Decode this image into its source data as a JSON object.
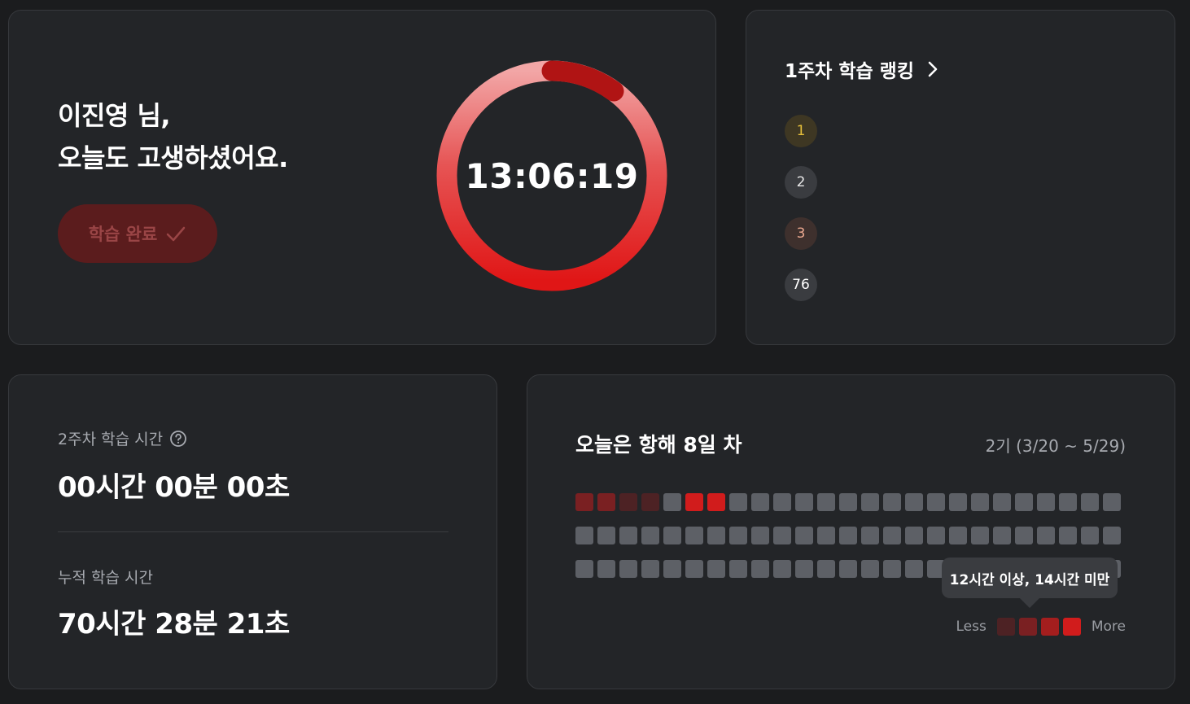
{
  "greeting": {
    "line1": "이진영 님,",
    "line2": "오늘도 고생하셨어요.",
    "button_label": "학습 완료"
  },
  "timer": {
    "text": "13:06:19"
  },
  "ranking": {
    "title": "1주차 학습 랭킹",
    "items": [
      {
        "rank": "1",
        "bg": "#3e3723",
        "color": "#e6bf3a"
      },
      {
        "rank": "2",
        "bg": "#3a3c40",
        "color": "#e8e8e8"
      },
      {
        "rank": "3",
        "bg": "#3e302d",
        "color": "#e9a68e"
      },
      {
        "rank": "76",
        "bg": "#3a3c40",
        "color": "#ffffff"
      }
    ]
  },
  "study_time": {
    "weekly_label": "2주차 학습 시간",
    "weekly_value": "00시간 00분 00초",
    "total_label": "누적 학습 시간",
    "total_value": "70시간 28분 21초"
  },
  "streak": {
    "title": "오늘은 항해 8일 차",
    "period": "2기 (3/20 ~ 5/29)",
    "rows": [
      [
        2,
        2,
        1,
        1,
        0,
        4,
        4,
        0,
        0,
        0,
        0,
        0,
        0,
        0,
        0,
        0,
        0,
        0,
        0,
        0,
        0,
        0,
        0,
        0,
        0
      ],
      [
        0,
        0,
        0,
        0,
        0,
        0,
        0,
        0,
        0,
        0,
        0,
        0,
        0,
        0,
        0,
        0,
        0,
        0,
        0,
        0,
        0,
        0,
        0,
        0,
        0
      ],
      [
        0,
        0,
        0,
        0,
        0,
        0,
        0,
        0,
        0,
        0,
        0,
        0,
        0,
        0,
        0,
        0,
        0,
        0,
        0,
        0,
        0,
        0,
        0,
        0,
        0
      ]
    ],
    "level_colors": [
      "#5d6066",
      "#4d2224",
      "#7a2022",
      "#a41e1e",
      "#d11c1c"
    ],
    "legend_less": "Less",
    "legend_more": "More",
    "tooltip": "12시간 이상, 14시간 미만"
  },
  "colors": {
    "accent": "#d11c1c",
    "card_bg": "#232528",
    "page_bg": "#1b1c1e"
  }
}
